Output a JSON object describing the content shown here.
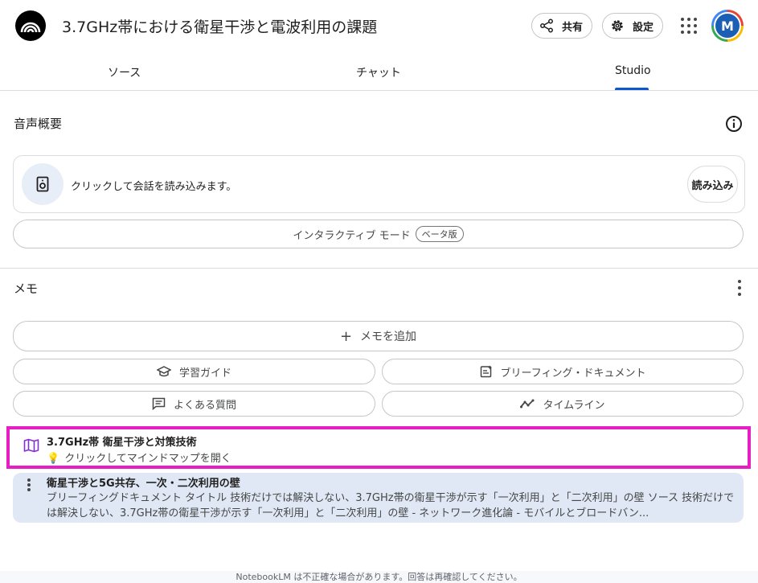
{
  "header": {
    "title": "3.7GHz帯における衛星干渉と電波利用の課題",
    "share_label": "共有",
    "settings_label": "設定",
    "avatar_initial": "M"
  },
  "tabs": [
    {
      "label": "ソース"
    },
    {
      "label": "チャット"
    },
    {
      "label": "Studio",
      "active": true
    }
  ],
  "audio": {
    "section_title": "音声概要",
    "load_text": "クリックして会話を読み込みます。",
    "load_button": "読み込み",
    "interactive_mode": "インタラクティブ モード",
    "beta_badge": "ベータ版"
  },
  "memo": {
    "section_title": "メモ",
    "add_memo": "メモを追加",
    "buttons": [
      {
        "label": "学習ガイド",
        "icon": "graduation-cap-icon"
      },
      {
        "label": "ブリーフィング・ドキュメント",
        "icon": "briefing-doc-icon"
      },
      {
        "label": "よくある質問",
        "icon": "faq-icon"
      },
      {
        "label": "タイムライン",
        "icon": "timeline-icon"
      }
    ],
    "items": [
      {
        "title": "3.7GHz帯 衛星干渉と対策技術",
        "subtitle": "クリックしてマインドマップを開く",
        "icon": "map-icon",
        "highlight_color": "#e61ec4"
      },
      {
        "title": "衛星干渉と5G共存、一次・二次利用の壁",
        "body": "ブリーフィングドキュメント タイトル 技術だけでは解決しない、3.7GHz帯の衛星干渉が示す「一次利用」と「二次利用」の壁 ソース 技術だけでは解決しない、3.7GHz帯の衛星干渉が示す「一次利用」と「二次利用」の壁 - ネットワーク進化論 - モバイルとブロードバン..."
      }
    ]
  },
  "footer": "NotebookLM は不正確な場合があります。回答は再確認してください。",
  "colors": {
    "accent": "#0b57d0",
    "highlight": "#e61ec4",
    "note_bg": "#e1e8f5"
  }
}
